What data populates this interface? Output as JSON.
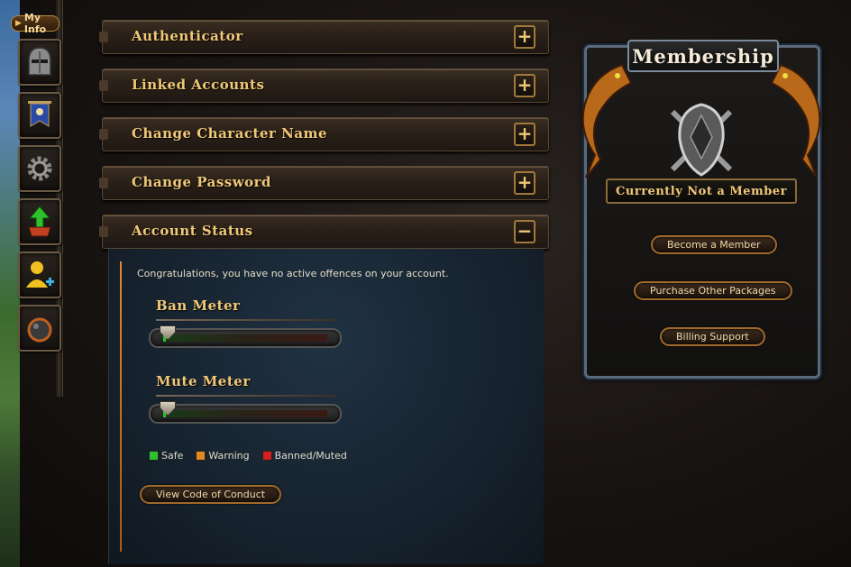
{
  "sidebar": {
    "tab_label": "My Info",
    "icons": [
      "helmet-icon",
      "banner-flag-icon",
      "gear-icon",
      "level-up-icon",
      "add-friend-icon",
      "bomb-icon"
    ]
  },
  "accordion": [
    {
      "title": "Authenticator",
      "toggle": "+"
    },
    {
      "title": "Linked Accounts",
      "toggle": "+"
    },
    {
      "title": "Change Character Name",
      "toggle": "+"
    },
    {
      "title": "Change Password",
      "toggle": "+"
    },
    {
      "title": "Account Status",
      "toggle": "−"
    }
  ],
  "account_status": {
    "message": "Congratulations, you have no active offences on your account.",
    "ban_meter": {
      "title": "Ban Meter",
      "level": 0
    },
    "mute_meter": {
      "title": "Mute Meter",
      "level": 0
    },
    "legend": [
      {
        "label": "Safe",
        "color": "#2ec02e"
      },
      {
        "label": "Warning",
        "color": "#e08a20"
      },
      {
        "label": "Banned/Muted",
        "color": "#d42020"
      }
    ],
    "conduct_button": "View Code of Conduct"
  },
  "membership": {
    "title": "Membership",
    "status": "Currently Not a Member",
    "buttons": [
      "Become a Member",
      "Purchase Other Packages",
      "Billing Support"
    ]
  },
  "colors": {
    "accent": "#f0c878",
    "button_border": "#a06a2a",
    "panel_bg": "#16222e"
  }
}
